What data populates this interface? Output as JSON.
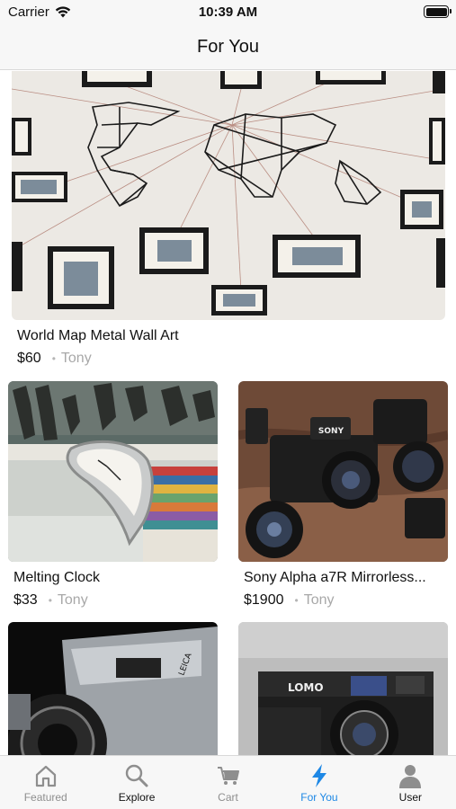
{
  "status_bar": {
    "carrier": "Carrier",
    "time": "10:39 AM"
  },
  "nav": {
    "title": "For You"
  },
  "products": [
    {
      "name": "World Map Metal Wall Art",
      "price": "$60",
      "seller": "Tony",
      "image": "world-map-wall-art"
    },
    {
      "name": "Melting Clock",
      "price": "$33",
      "seller": "Tony",
      "image": "melting-clock"
    },
    {
      "name": "Sony Alpha a7R Mirrorless...",
      "price": "$1900",
      "seller": "Tony",
      "image": "sony-camera"
    },
    {
      "name": "",
      "price": "",
      "seller": "",
      "image": "leica-camera"
    },
    {
      "name": "",
      "price": "",
      "seller": "",
      "image": "lomo-camera"
    }
  ],
  "tabs": [
    {
      "label": "Featured",
      "icon": "home-icon",
      "active": false
    },
    {
      "label": "Explore",
      "icon": "search-icon",
      "active": false
    },
    {
      "label": "Cart",
      "icon": "cart-icon",
      "active": false
    },
    {
      "label": "For You",
      "icon": "bolt-icon",
      "active": true
    },
    {
      "label": "User",
      "icon": "user-icon",
      "active": false
    }
  ],
  "colors": {
    "accent": "#1e88e5",
    "bar_background": "#f7f7f7",
    "muted_text": "#a8a8a8"
  }
}
